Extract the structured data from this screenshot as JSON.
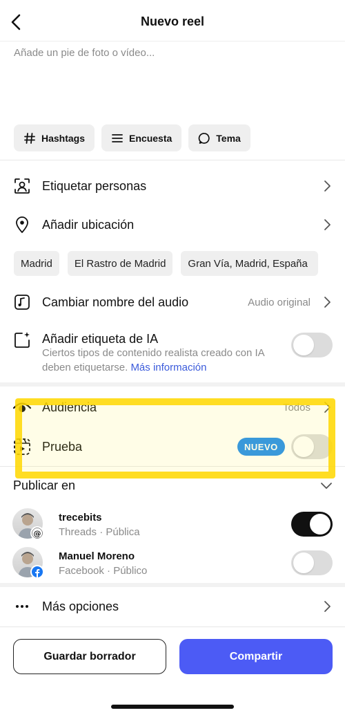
{
  "header": {
    "title": "Nuevo reel"
  },
  "caption": {
    "placeholder": "Añade un pie de foto o vídeo..."
  },
  "chips": [
    {
      "label": "Hashtags",
      "icon": "hashtag-icon"
    },
    {
      "label": "Encuesta",
      "icon": "list-icon"
    },
    {
      "label": "Tema",
      "icon": "speech-bubble-icon"
    }
  ],
  "rows": {
    "tag_people": "Etiquetar personas",
    "add_location": "Añadir ubicación",
    "rename_audio": "Cambiar nombre del audio",
    "audio_value": "Audio original",
    "ai_label": "Añadir etiqueta de IA",
    "ai_desc": "Ciertos tipos de contenido realista creado con IA deben etiquetarse.",
    "ai_more": "Más información",
    "audience": "Audiencia",
    "audience_value": "Todos",
    "trial": "Prueba",
    "trial_badge": "NUEVO",
    "publish_in": "Publicar en",
    "more_options": "Más opciones"
  },
  "locations": [
    "Madrid",
    "El Rastro de Madrid",
    "Gran Vía, Madrid, España"
  ],
  "accounts": [
    {
      "name": "trecebits",
      "sub": "Threads · Pública",
      "on": true,
      "platform": "threads-icon"
    },
    {
      "name": "Manuel Moreno",
      "sub": "Facebook · Público",
      "on": false,
      "platform": "facebook-icon"
    }
  ],
  "buttons": {
    "draft": "Guardar borrador",
    "share": "Compartir"
  },
  "colors": {
    "share": "#4c5bf5",
    "link": "#3b5bdb",
    "badge": "#1f8ef1",
    "highlight": "#ffd700"
  }
}
